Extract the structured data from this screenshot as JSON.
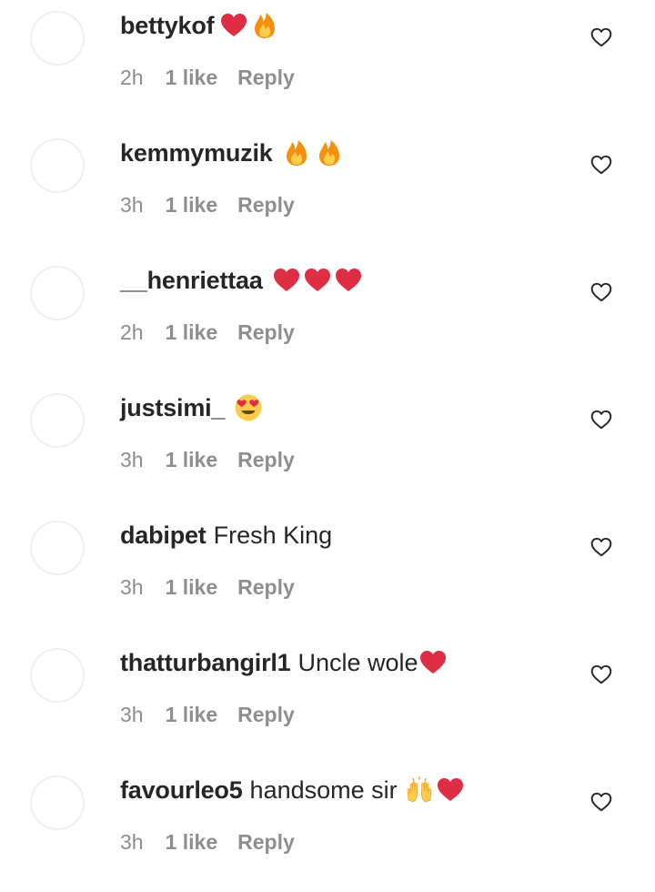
{
  "comments": [
    {
      "username": "bettykof",
      "text": "",
      "emojis": [
        "red-heart",
        "fire"
      ],
      "time": "2h",
      "likes": "1 like",
      "reply": "Reply"
    },
    {
      "username": "kemmymuzik",
      "text": "",
      "emojis": [
        "fire",
        "fire"
      ],
      "time": "3h",
      "likes": "1 like",
      "reply": "Reply"
    },
    {
      "username": "__henriettaa",
      "text": "",
      "emojis": [
        "red-heart",
        "red-heart",
        "red-heart"
      ],
      "time": "2h",
      "likes": "1 like",
      "reply": "Reply"
    },
    {
      "username": "justsimi_",
      "text": "",
      "emojis": [
        "heart-eyes"
      ],
      "time": "3h",
      "likes": "1 like",
      "reply": "Reply"
    },
    {
      "username": "dabipet",
      "text": "Fresh King",
      "emojis": [],
      "time": "3h",
      "likes": "1 like",
      "reply": "Reply"
    },
    {
      "username": "thatturbangirl1",
      "text": "Uncle wole",
      "emojis": [
        "red-heart"
      ],
      "time": "3h",
      "likes": "1 like",
      "reply": "Reply"
    },
    {
      "username": "favourleo5",
      "text": "handsome sir",
      "emojis": [
        "raising-hands",
        "red-heart"
      ],
      "time": "3h",
      "likes": "1 like",
      "reply": "Reply"
    }
  ],
  "colors": {
    "text": "#262626",
    "meta": "#8e8e8e",
    "avatar_border": "#efefef",
    "heart_emoji": "#dd2e44",
    "fire_outer": "#f4900c",
    "fire_inner": "#ffcc4d"
  },
  "icons": {
    "like_button": "heart-outline-icon"
  }
}
